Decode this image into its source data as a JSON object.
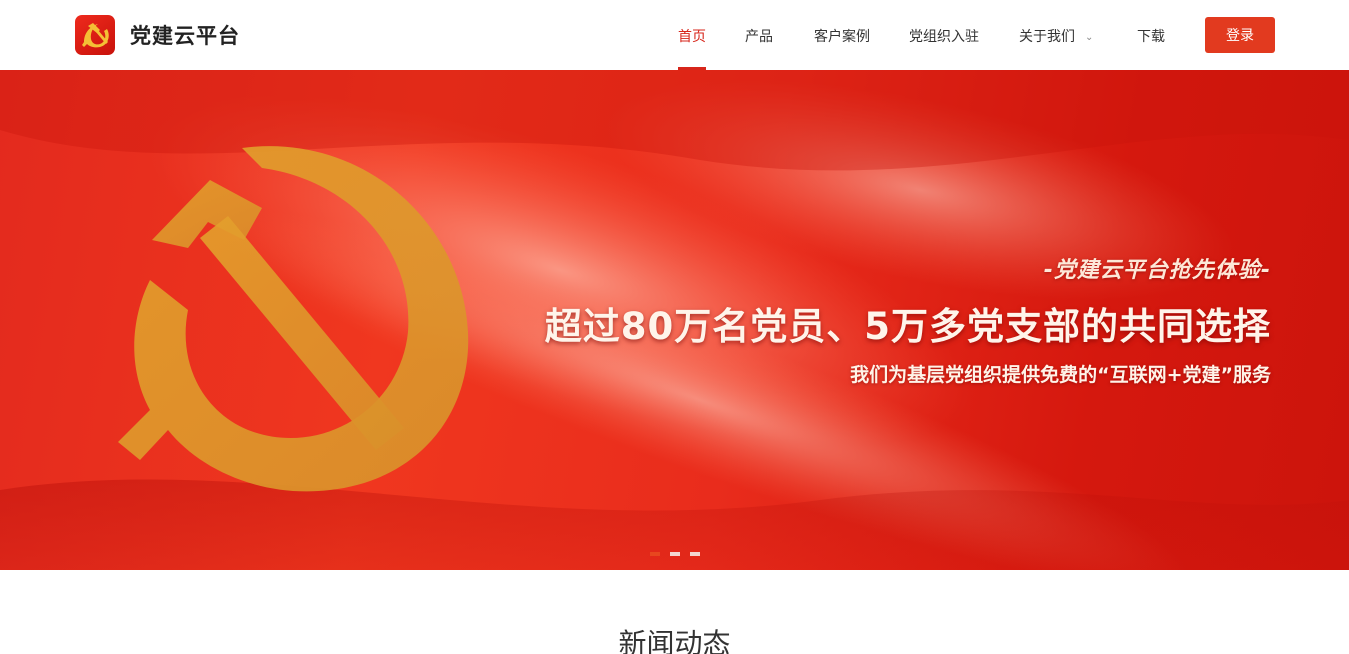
{
  "header": {
    "brand": "党建云平台",
    "logo_icon": "hammer-sickle-icon",
    "nav": [
      {
        "label": "首页",
        "active": true
      },
      {
        "label": "产品",
        "active": false
      },
      {
        "label": "客户案例",
        "active": false
      },
      {
        "label": "党组织入驻",
        "active": false
      },
      {
        "label": "关于我们",
        "active": false,
        "has_dropdown": true
      },
      {
        "label": "下载",
        "active": false
      }
    ],
    "login_label": "登录"
  },
  "banner": {
    "subtitle": "-党建云平台抢先体验-",
    "title": "超过80万名党员、5万多党支部的共同选择",
    "description": "我们为基层党组织提供免费的“互联网+党建”服务",
    "slides_count": 3,
    "active_slide": 1
  },
  "news": {
    "title": "新闻动态"
  },
  "colors": {
    "accent": "#d7261b",
    "login_bg": "#e23a1f",
    "banner_red": "#e32a1e",
    "emblem_gold": "#e9a82e"
  }
}
